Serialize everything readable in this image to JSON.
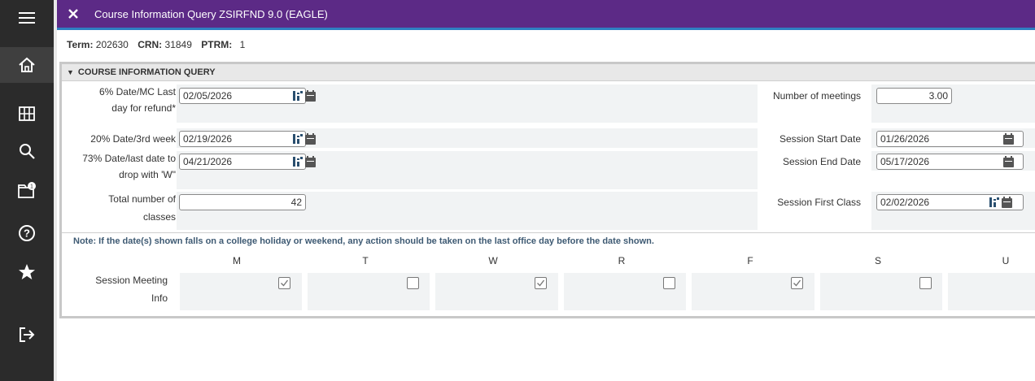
{
  "header": {
    "title": "Course Information Query ZSIRFND 9.0 (EAGLE)"
  },
  "key": {
    "term_label": "Term:",
    "term_value": "202630",
    "crn_label": "CRN:",
    "crn_value": "31849",
    "ptrm_label": "PTRM:",
    "ptrm_value": "1"
  },
  "section": {
    "title": "COURSE INFORMATION QUERY"
  },
  "left_fields": {
    "refund_label_1": "6% Date/MC Last",
    "refund_label_2": "day for refund*",
    "refund_value": "02/05/2026",
    "third_week_label": "20% Date/3rd week",
    "third_week_value": "02/19/2026",
    "drop_label_1": "73% Date/last date to",
    "drop_label_2": "drop with 'W\"",
    "drop_value": "04/21/2026",
    "classes_label_1": "Total number of",
    "classes_label_2": "classes",
    "classes_value": "42"
  },
  "right_fields": {
    "meetings_label": "Number of meetings",
    "meetings_value": "3.00",
    "start_label": "Session Start Date",
    "start_value": "01/26/2026",
    "end_label": "Session End Date",
    "end_value": "05/17/2026",
    "first_class_label": "Session First Class",
    "first_class_value": "02/02/2026"
  },
  "note": "Note: If the date(s) shown falls on a college holiday or weekend, any action should be taken on the last office day before the date shown.",
  "meeting": {
    "label_1": "Session Meeting",
    "label_2": "Info",
    "days": [
      "M",
      "T",
      "W",
      "R",
      "F",
      "S",
      "U"
    ],
    "checked": [
      true,
      false,
      true,
      false,
      true,
      false,
      false
    ]
  },
  "colors": {
    "header": "#5c2a86",
    "accent_line": "#2f7fc1",
    "nav": "#2b2b2b"
  },
  "icons": [
    "hamburger-icon",
    "home-icon",
    "grid-icon",
    "search-icon",
    "folder-icon",
    "help-icon",
    "star-icon",
    "sign-out-icon",
    "close-icon",
    "calendar-icon",
    "date-picker-icon"
  ]
}
